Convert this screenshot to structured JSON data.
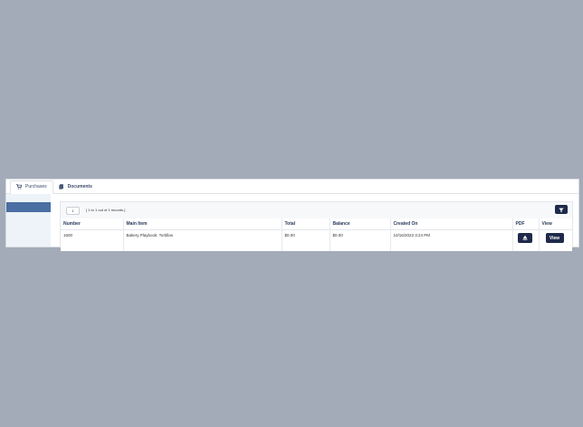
{
  "tabs": [
    {
      "label": "Purchases",
      "icon": "cart-icon"
    },
    {
      "label": "Documents",
      "icon": "documents-icon"
    }
  ],
  "pagination": {
    "page": "1",
    "records_text": "[ 1 to 1 out of 1 records ]"
  },
  "table": {
    "headers": [
      "Number",
      "Main Item",
      "Total",
      "Balance",
      "Created On",
      "PDF",
      "View"
    ],
    "rows": [
      {
        "number": "1600",
        "main_item": "Bakery Playbook: Tortillas",
        "total": "$0.00",
        "balance": "$0.00",
        "created_on": "10/16/2023 3:24 PM",
        "view_label": "View"
      }
    ]
  },
  "colors": {
    "background": "#a3abb8",
    "accent": "#1e2a4a",
    "sidebar_active": "#4b6fa3"
  }
}
